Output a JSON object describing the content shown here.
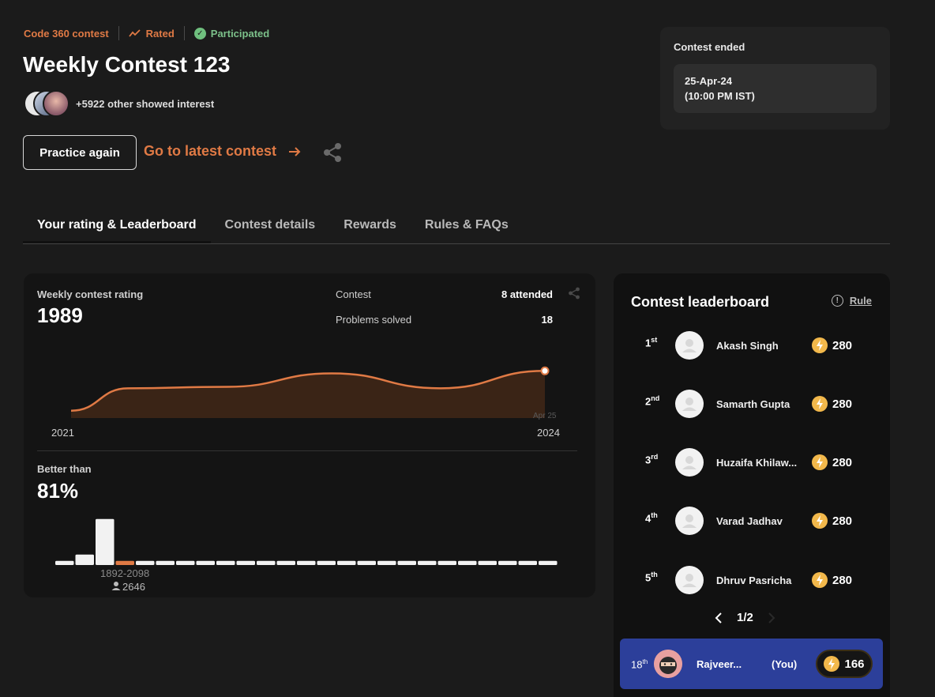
{
  "header": {
    "contest_type": "Code 360 contest",
    "rated": "Rated",
    "participated": "Participated",
    "title": "Weekly Contest 123",
    "interest_text": "+5922 other showed interest",
    "practice_button": "Practice again",
    "latest_link": "Go to latest contest"
  },
  "ended": {
    "label": "Contest ended",
    "date": "25-Apr-24",
    "time": "(10:00 PM IST)"
  },
  "tabs": [
    {
      "label": "Your rating & Leaderboard",
      "active": true
    },
    {
      "label": "Contest details",
      "active": false
    },
    {
      "label": "Rewards",
      "active": false
    },
    {
      "label": "Rules & FAQs",
      "active": false
    }
  ],
  "rating": {
    "label": "Weekly contest rating",
    "value": "1989",
    "stats": [
      {
        "key": "Contest",
        "value": "8 attended"
      },
      {
        "key": "Problems solved",
        "value": "18"
      }
    ],
    "better_than_label": "Better than",
    "better_than_value": "81%"
  },
  "chart_data": [
    {
      "type": "area",
      "x_tick_labels": [
        "2021",
        "2024"
      ],
      "annotation": "Apr 25",
      "x": [
        0,
        0.12,
        0.33,
        0.55,
        0.78,
        1.0
      ],
      "y": [
        0.1,
        0.55,
        0.58,
        0.85,
        0.55,
        0.9
      ],
      "ylim": [
        0,
        1
      ],
      "grid": false,
      "colors": {
        "line": "#e07a45",
        "fill": "#3a2416"
      }
    },
    {
      "type": "bar",
      "values": [
        1,
        2.5,
        11,
        1,
        1,
        1,
        1,
        1,
        1,
        1,
        1,
        1,
        1,
        1,
        1,
        1,
        1,
        1,
        1,
        1,
        1,
        1,
        1,
        1,
        1
      ],
      "highlight_index": 3,
      "highlight_range_label": "1892-2098",
      "highlight_count_label": "2646",
      "colors": {
        "bar": "#f2f2f2",
        "highlight": "#e07a45"
      }
    }
  ],
  "leaderboard": {
    "title": "Contest leaderboard",
    "rule_label": "Rule",
    "entries": [
      {
        "rank": "1",
        "suffix": "st",
        "name": "Akash Singh",
        "score": "280"
      },
      {
        "rank": "2",
        "suffix": "nd",
        "name": "Samarth Gupta",
        "score": "280"
      },
      {
        "rank": "3",
        "suffix": "rd",
        "name": "Huzaifa Khilaw...",
        "score": "280"
      },
      {
        "rank": "4",
        "suffix": "th",
        "name": "Varad Jadhav",
        "score": "280"
      },
      {
        "rank": "5",
        "suffix": "th",
        "name": "Dhruv Pasricha",
        "score": "280"
      }
    ],
    "pager": "1/2",
    "you": {
      "rank": "18",
      "suffix": "th",
      "name": "Rajveer...",
      "tag": "(You)",
      "score": "166"
    }
  },
  "colors": {
    "accent": "#e07a45",
    "success": "#6fbf7e",
    "you_card": "#2c3f9a",
    "coin": "#f2b84b"
  }
}
